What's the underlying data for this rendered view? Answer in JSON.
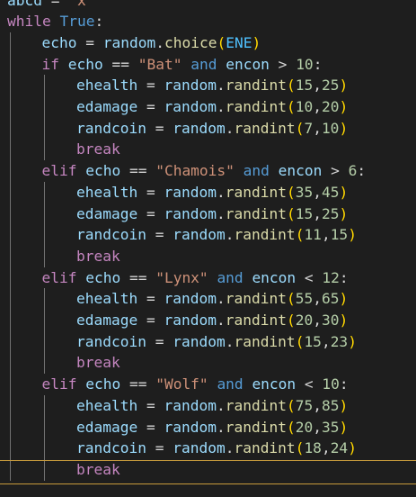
{
  "editor": {
    "lines": [
      {
        "indent": 0,
        "tokens": [
          [
            "var",
            "abcd"
          ],
          [
            "op",
            " = "
          ],
          [
            "str",
            "\"x\""
          ]
        ]
      },
      {
        "indent": 0,
        "tokens": [
          [
            "kw",
            "while"
          ],
          [
            "op",
            " "
          ],
          [
            "kw2",
            "True"
          ],
          [
            "op",
            ":"
          ]
        ]
      },
      {
        "indent": 1,
        "tokens": [
          [
            "var",
            "echo"
          ],
          [
            "op",
            " = "
          ],
          [
            "var",
            "random"
          ],
          [
            "op",
            "."
          ],
          [
            "func",
            "choice"
          ],
          [
            "p1",
            "("
          ],
          [
            "const",
            "ENE"
          ],
          [
            "p1",
            ")"
          ]
        ]
      },
      {
        "indent": 1,
        "tokens": [
          [
            "kw",
            "if"
          ],
          [
            "op",
            " "
          ],
          [
            "var",
            "echo"
          ],
          [
            "op",
            " == "
          ],
          [
            "str",
            "\"Bat\""
          ],
          [
            "op",
            " "
          ],
          [
            "kw2",
            "and"
          ],
          [
            "op",
            " "
          ],
          [
            "var",
            "encon"
          ],
          [
            "op",
            " > "
          ],
          [
            "num",
            "10"
          ],
          [
            "op",
            ":"
          ]
        ]
      },
      {
        "indent": 2,
        "tokens": [
          [
            "var",
            "ehealth"
          ],
          [
            "op",
            " = "
          ],
          [
            "var",
            "random"
          ],
          [
            "op",
            "."
          ],
          [
            "func",
            "randint"
          ],
          [
            "p1",
            "("
          ],
          [
            "num",
            "15"
          ],
          [
            "op",
            ","
          ],
          [
            "num",
            "25"
          ],
          [
            "p1",
            ")"
          ]
        ]
      },
      {
        "indent": 2,
        "tokens": [
          [
            "var",
            "edamage"
          ],
          [
            "op",
            " = "
          ],
          [
            "var",
            "random"
          ],
          [
            "op",
            "."
          ],
          [
            "func",
            "randint"
          ],
          [
            "p1",
            "("
          ],
          [
            "num",
            "10"
          ],
          [
            "op",
            ","
          ],
          [
            "num",
            "20"
          ],
          [
            "p1",
            ")"
          ]
        ]
      },
      {
        "indent": 2,
        "tokens": [
          [
            "var",
            "randcoin"
          ],
          [
            "op",
            " = "
          ],
          [
            "var",
            "random"
          ],
          [
            "op",
            "."
          ],
          [
            "func",
            "randint"
          ],
          [
            "p1",
            "("
          ],
          [
            "num",
            "7"
          ],
          [
            "op",
            ","
          ],
          [
            "num",
            "10"
          ],
          [
            "p1",
            ")"
          ]
        ]
      },
      {
        "indent": 2,
        "tokens": [
          [
            "kw",
            "break"
          ]
        ]
      },
      {
        "indent": 1,
        "tokens": [
          [
            "kw",
            "elif"
          ],
          [
            "op",
            " "
          ],
          [
            "var",
            "echo"
          ],
          [
            "op",
            " == "
          ],
          [
            "str",
            "\"Chamois\""
          ],
          [
            "op",
            " "
          ],
          [
            "kw2",
            "and"
          ],
          [
            "op",
            " "
          ],
          [
            "var",
            "encon"
          ],
          [
            "op",
            " > "
          ],
          [
            "num",
            "6"
          ],
          [
            "op",
            ":"
          ]
        ]
      },
      {
        "indent": 2,
        "tokens": [
          [
            "var",
            "ehealth"
          ],
          [
            "op",
            " = "
          ],
          [
            "var",
            "random"
          ],
          [
            "op",
            "."
          ],
          [
            "func",
            "randint"
          ],
          [
            "p1",
            "("
          ],
          [
            "num",
            "35"
          ],
          [
            "op",
            ","
          ],
          [
            "num",
            "45"
          ],
          [
            "p1",
            ")"
          ]
        ]
      },
      {
        "indent": 2,
        "tokens": [
          [
            "var",
            "edamage"
          ],
          [
            "op",
            " = "
          ],
          [
            "var",
            "random"
          ],
          [
            "op",
            "."
          ],
          [
            "func",
            "randint"
          ],
          [
            "p1",
            "("
          ],
          [
            "num",
            "15"
          ],
          [
            "op",
            ","
          ],
          [
            "num",
            "25"
          ],
          [
            "p1",
            ")"
          ]
        ]
      },
      {
        "indent": 2,
        "tokens": [
          [
            "var",
            "randcoin"
          ],
          [
            "op",
            " = "
          ],
          [
            "var",
            "random"
          ],
          [
            "op",
            "."
          ],
          [
            "func",
            "randint"
          ],
          [
            "p1",
            "("
          ],
          [
            "num",
            "11"
          ],
          [
            "op",
            ","
          ],
          [
            "num",
            "15"
          ],
          [
            "p1",
            ")"
          ]
        ]
      },
      {
        "indent": 2,
        "tokens": [
          [
            "kw",
            "break"
          ]
        ]
      },
      {
        "indent": 1,
        "tokens": [
          [
            "kw",
            "elif"
          ],
          [
            "op",
            " "
          ],
          [
            "var",
            "echo"
          ],
          [
            "op",
            " == "
          ],
          [
            "str",
            "\"Lynx\""
          ],
          [
            "op",
            " "
          ],
          [
            "kw2",
            "and"
          ],
          [
            "op",
            " "
          ],
          [
            "var",
            "encon"
          ],
          [
            "op",
            " < "
          ],
          [
            "num",
            "12"
          ],
          [
            "op",
            ":"
          ]
        ]
      },
      {
        "indent": 2,
        "tokens": [
          [
            "var",
            "ehealth"
          ],
          [
            "op",
            " = "
          ],
          [
            "var",
            "random"
          ],
          [
            "op",
            "."
          ],
          [
            "func",
            "randint"
          ],
          [
            "p1",
            "("
          ],
          [
            "num",
            "55"
          ],
          [
            "op",
            ","
          ],
          [
            "num",
            "65"
          ],
          [
            "p1",
            ")"
          ]
        ]
      },
      {
        "indent": 2,
        "tokens": [
          [
            "var",
            "edamage"
          ],
          [
            "op",
            " = "
          ],
          [
            "var",
            "random"
          ],
          [
            "op",
            "."
          ],
          [
            "func",
            "randint"
          ],
          [
            "p1",
            "("
          ],
          [
            "num",
            "20"
          ],
          [
            "op",
            ","
          ],
          [
            "num",
            "30"
          ],
          [
            "p1",
            ")"
          ]
        ]
      },
      {
        "indent": 2,
        "tokens": [
          [
            "var",
            "randcoin"
          ],
          [
            "op",
            " = "
          ],
          [
            "var",
            "random"
          ],
          [
            "op",
            "."
          ],
          [
            "func",
            "randint"
          ],
          [
            "p1",
            "("
          ],
          [
            "num",
            "15"
          ],
          [
            "op",
            ","
          ],
          [
            "num",
            "23"
          ],
          [
            "p1",
            ")"
          ]
        ]
      },
      {
        "indent": 2,
        "tokens": [
          [
            "kw",
            "break"
          ]
        ]
      },
      {
        "indent": 1,
        "tokens": [
          [
            "kw",
            "elif"
          ],
          [
            "op",
            " "
          ],
          [
            "var",
            "echo"
          ],
          [
            "op",
            " == "
          ],
          [
            "str",
            "\"Wolf\""
          ],
          [
            "op",
            " "
          ],
          [
            "kw2",
            "and"
          ],
          [
            "op",
            " "
          ],
          [
            "var",
            "encon"
          ],
          [
            "op",
            " < "
          ],
          [
            "num",
            "10"
          ],
          [
            "op",
            ":"
          ]
        ]
      },
      {
        "indent": 2,
        "tokens": [
          [
            "var",
            "ehealth"
          ],
          [
            "op",
            " = "
          ],
          [
            "var",
            "random"
          ],
          [
            "op",
            "."
          ],
          [
            "func",
            "randint"
          ],
          [
            "p1",
            "("
          ],
          [
            "num",
            "75"
          ],
          [
            "op",
            ","
          ],
          [
            "num",
            "85"
          ],
          [
            "p1",
            ")"
          ]
        ]
      },
      {
        "indent": 2,
        "tokens": [
          [
            "var",
            "edamage"
          ],
          [
            "op",
            " = "
          ],
          [
            "var",
            "random"
          ],
          [
            "op",
            "."
          ],
          [
            "func",
            "randint"
          ],
          [
            "p1",
            "("
          ],
          [
            "num",
            "20"
          ],
          [
            "op",
            ","
          ],
          [
            "num",
            "35"
          ],
          [
            "p1",
            ")"
          ]
        ]
      },
      {
        "indent": 2,
        "tokens": [
          [
            "var",
            "randcoin"
          ],
          [
            "op",
            " = "
          ],
          [
            "var",
            "random"
          ],
          [
            "op",
            "."
          ],
          [
            "func",
            "randint"
          ],
          [
            "p1",
            "("
          ],
          [
            "num",
            "18"
          ],
          [
            "op",
            ","
          ],
          [
            "num",
            "24"
          ],
          [
            "p1",
            ")"
          ]
        ]
      },
      {
        "indent": 2,
        "tokens": [
          [
            "kw",
            "break"
          ]
        ]
      }
    ]
  }
}
